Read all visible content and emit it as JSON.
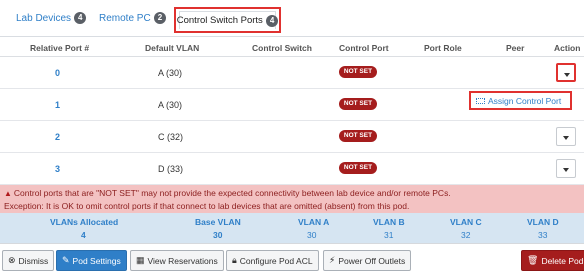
{
  "tabs": {
    "lab_devices": {
      "label": "Lab Devices",
      "count": "4"
    },
    "remote_pc": {
      "label": "Remote PC",
      "count": "2"
    },
    "control_switch_ports": {
      "label": "Control Switch Ports",
      "count": "4"
    }
  },
  "table": {
    "headers": {
      "relative_port": "Relative Port #",
      "default_vlan": "Default VLAN",
      "control_switch": "Control Switch",
      "control_port": "Control Port",
      "port_role": "Port Role",
      "peer": "Peer",
      "action": "Action"
    },
    "rows": [
      {
        "port": "0",
        "vlan": "A (30)",
        "control_port": "NOT SET"
      },
      {
        "port": "1",
        "vlan": "A (30)",
        "control_port": "NOT SET"
      },
      {
        "port": "2",
        "vlan": "C (32)",
        "control_port": "NOT SET"
      },
      {
        "port": "3",
        "vlan": "D (33)",
        "control_port": "NOT SET"
      }
    ]
  },
  "menu": {
    "assign_control_port": "Assign Control Port"
  },
  "warning": {
    "line1": "Control ports that are \"NOT SET\" may not provide the expected connectivity between lab device and/or remote PCs.",
    "line2": "Exception: It is OK to omit control ports if that connect to lab devices that are omitted (absent) from this pod."
  },
  "vlans": {
    "allocated_label": "VLANs Allocated",
    "allocated_value": "4",
    "base_label": "Base VLAN",
    "base_value": "30",
    "a_label": "VLAN A",
    "a_value": "30",
    "b_label": "VLAN B",
    "b_value": "31",
    "c_label": "VLAN C",
    "c_value": "32",
    "d_label": "VLAN D",
    "d_value": "33"
  },
  "footer": {
    "dismiss": "Dismiss",
    "pod_settings": "Pod Settings",
    "view_reservations": "View Reservations",
    "configure_pod_acl": "Configure Pod ACL",
    "power_off_outlets": "Power Off Outlets",
    "delete_pod": "Delete Pod"
  },
  "colors": {
    "accent": "#2f7fc8",
    "danger": "#a51d1d",
    "highlight": "#e0312f",
    "warning_bg": "#f3c2c2",
    "summary_bg": "#d6e5f2"
  }
}
